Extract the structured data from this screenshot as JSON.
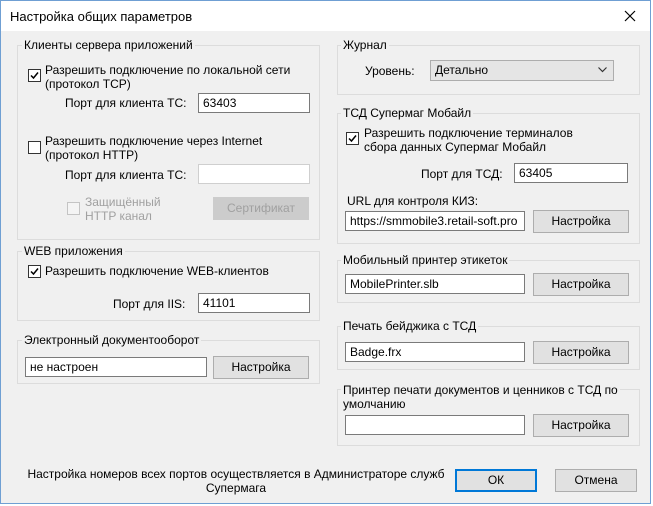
{
  "window": {
    "title": "Настройка общих параметров"
  },
  "app_clients": {
    "title": "Клиенты сервера приложений",
    "lan_label": "Разрешить подключение по локальной сети\n(протокол TCP)",
    "lan_checked": true,
    "port_label": "Порт для клиента ТС:",
    "port_value": "63403",
    "inet_label": "Разрешить подключение через Internet\n(протокол HTTP)",
    "inet_checked": false,
    "inet_port_label": "Порт для клиента ТС:",
    "inet_port_value": "",
    "secure_label": "Защищённый\nHTTP канал",
    "cert_button": "Сертификат"
  },
  "web_apps": {
    "title": "WEB приложения",
    "allow_label": "Разрешить подключение WEB-клиентов",
    "allow_checked": true,
    "iis_port_label": "Порт для IIS:",
    "iis_port_value": "41101"
  },
  "edo": {
    "title": "Электронный документооборот",
    "value": "не настроен",
    "settings_button": "Настройка"
  },
  "journal": {
    "title": "Журнал",
    "level_label": "Уровень:",
    "level_value": "Детально"
  },
  "tsd": {
    "title": "ТСД Супермаг Мобайл",
    "allow_label": "Разрешить подключение терминалов\nсбора данных Супермаг Мобайл",
    "allow_checked": true,
    "port_label": "Порт для ТСД:",
    "port_value": "63405",
    "kiz_label": "URL для контроля КИЗ:",
    "kiz_value": "https://smmobile3.retail-soft.pro",
    "settings_button": "Настройка"
  },
  "mobile_printer": {
    "title": "Мобильный принтер этикеток",
    "value": "MobilePrinter.slb",
    "settings_button": "Настройка"
  },
  "badge": {
    "title": "Печать бейджика с ТСД",
    "value": "Badge.frx",
    "settings_button": "Настройка"
  },
  "doc_printer": {
    "title": "Принтер печати документов и ценников с ТСД по\nумолчанию",
    "value": "",
    "settings_button": "Настройка"
  },
  "footer": {
    "note": "Настройка номеров всех портов осуществляется в Администраторе служб\nСупермага",
    "ok_button": "ОК",
    "cancel_button": "Отмена"
  },
  "colors": {
    "accent": "#0078d7",
    "frame": "#6f9fd3"
  }
}
